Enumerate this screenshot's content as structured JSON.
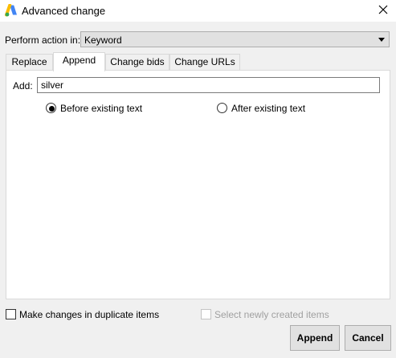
{
  "window": {
    "title": "Advanced change",
    "logo_icon": "google-ads-logo",
    "close_icon": "close-icon"
  },
  "perform": {
    "label": "Perform action in:",
    "value": "Keyword"
  },
  "tabs": [
    {
      "label": "Replace",
      "active": false
    },
    {
      "label": "Append",
      "active": true
    },
    {
      "label": "Change bids",
      "active": false
    },
    {
      "label": "Change URLs",
      "active": false
    }
  ],
  "append": {
    "add_label": "Add:",
    "add_value": "silver",
    "options": [
      {
        "label": "Before existing text",
        "selected": true
      },
      {
        "label": "After existing text",
        "selected": false
      }
    ]
  },
  "footer": {
    "duplicate_label": "Make changes in duplicate items",
    "duplicate_checked": false,
    "select_new_label": "Select newly created items",
    "select_new_enabled": false,
    "append_button": "Append",
    "cancel_button": "Cancel"
  },
  "colors": {
    "logo_blue": "#4285F4",
    "logo_yellow": "#FBBC04",
    "logo_green": "#34A853"
  }
}
